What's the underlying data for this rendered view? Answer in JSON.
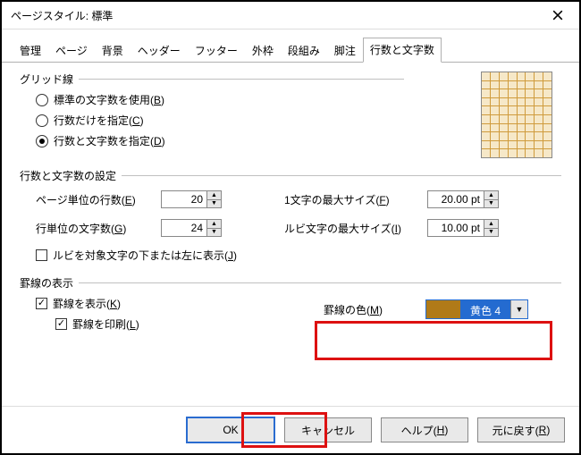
{
  "window": {
    "title": "ページスタイル: 標準"
  },
  "tabs": [
    {
      "label": "管理"
    },
    {
      "label": "ページ"
    },
    {
      "label": "背景"
    },
    {
      "label": "ヘッダー"
    },
    {
      "label": "フッター"
    },
    {
      "label": "外枠"
    },
    {
      "label": "段組み"
    },
    {
      "label": "脚注"
    },
    {
      "label": "行数と文字数"
    }
  ],
  "grid": {
    "group_label": "グリッド線",
    "opt_b": "標準の文字数を使用(B)",
    "opt_c": "行数だけを指定(C)",
    "opt_d": "行数と文字数を指定(D)"
  },
  "layout": {
    "group_label": "行数と文字数の設定",
    "lines_label": "ページ単位の行数(E)",
    "lines_val": "20",
    "chars_label": "行単位の文字数(G)",
    "chars_val": "24",
    "char_max_label": "1文字の最大サイズ(F)",
    "char_max_val": "20.00 pt",
    "ruby_max_label": "ルビ文字の最大サイズ(I)",
    "ruby_max_val": "10.00 pt",
    "ruby_pos": "ルビを対象文字の下または左に表示(J)"
  },
  "keisen": {
    "group_label": "罫線の表示",
    "show": "罫線を表示(K)",
    "print": "罫線を印刷(L)",
    "color_label": "罫線の色(M)",
    "color_name": "黄色 4",
    "color_hex": "#b07a18"
  },
  "buttons": {
    "ok": "OK",
    "cancel": "キャンセル",
    "help": "ヘルプ(H)",
    "reset": "元に戻す(R)"
  }
}
